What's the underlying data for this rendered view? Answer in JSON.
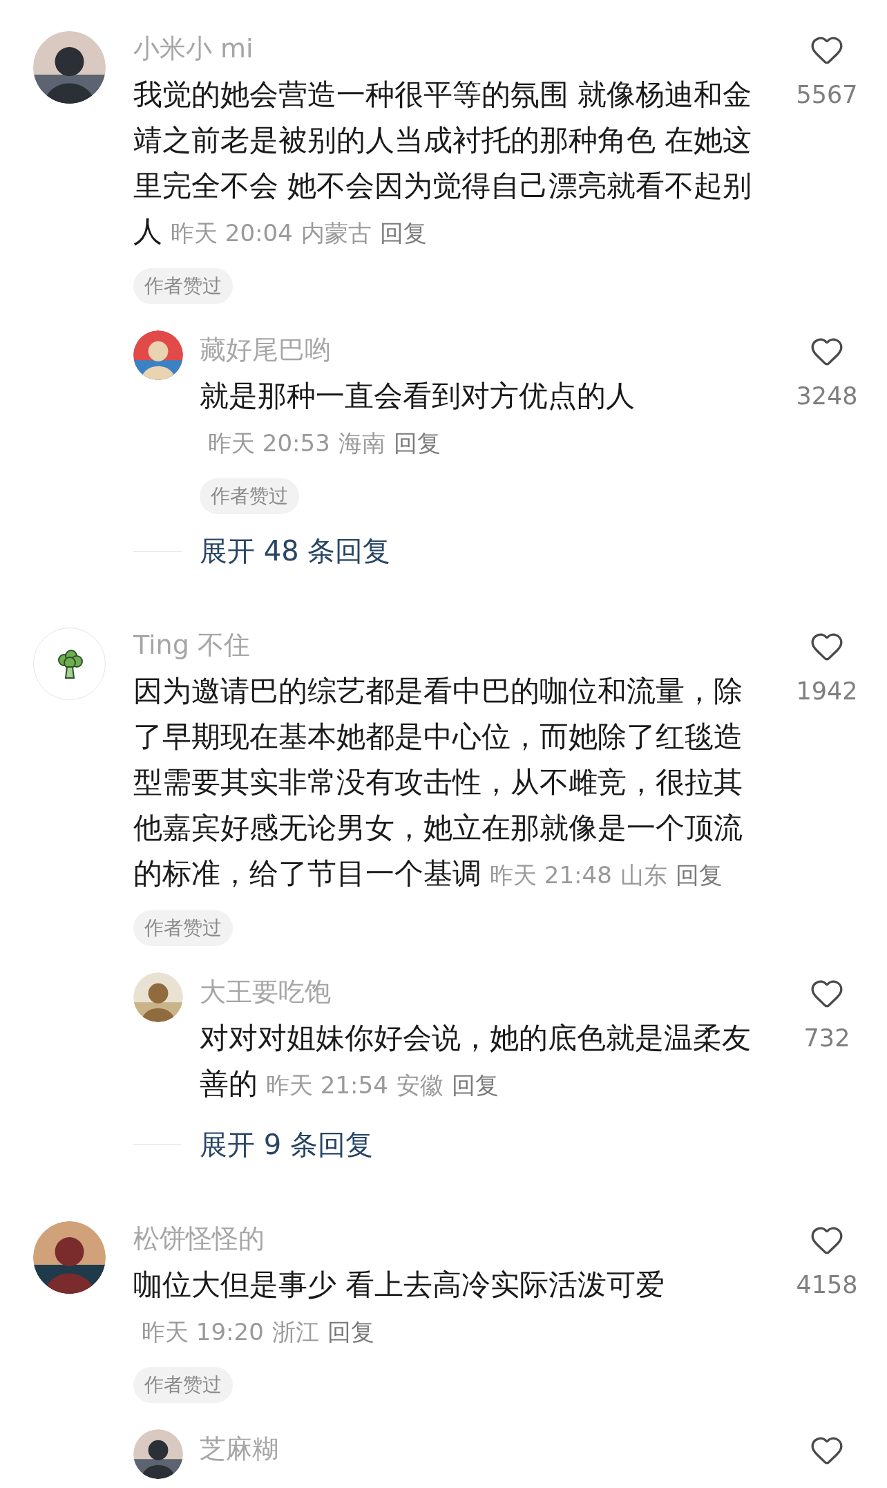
{
  "comments": [
    {
      "name": "小米小 mi",
      "body": "我觉的她会营造一种很平等的氛围 就像杨迪和金靖之前老是被别的人当成衬托的那种角色 在她这里完全不会 她不会因为觉得自己漂亮就看不起别人",
      "time": "昨天 20:04",
      "location": "内蒙古",
      "reply": "回复",
      "badge": "作者赞过",
      "likes": "5567",
      "replies": [
        {
          "name": "藏好尾巴哟",
          "body": "就是那种一直会看到对方优点的人",
          "time": "昨天 20:53",
          "location": "海南",
          "reply": "回复",
          "badge": "作者赞过",
          "likes": "3248"
        }
      ],
      "expand": "展开 48 条回复"
    },
    {
      "name": "Ting 不住",
      "avatar": {
        "kind": "icon"
      },
      "body": "因为邀请巴的综艺都是看中巴的咖位和流量，除了早期现在基本她都是中心位，而她除了红毯造型需要其实非常没有攻击性，从不雌竞，很拉其他嘉宾好感无论男女，她立在那就像是一个顶流的标准，给了节目一个基调",
      "time": "昨天 21:48",
      "location": "山东",
      "reply": "回复",
      "badge": "作者赞过",
      "likes": "1942",
      "replies": [
        {
          "name": "大王要吃饱",
          "body": "对对对姐妹你好会说，她的底色就是温柔友善的",
          "time": "昨天 21:54",
          "location": "安徽",
          "reply": "回复",
          "likes": "732"
        }
      ],
      "expand": "展开 9 条回复"
    },
    {
      "name": "松饼怪怪的",
      "body": "咖位大但是事少 看上去高冷实际活泼可爱",
      "time": "昨天 19:20",
      "location": "浙江",
      "reply": "回复",
      "badge": "作者赞过",
      "likes": "4158",
      "replies": [
        {
          "name": "芝麻糊"
        }
      ]
    }
  ]
}
